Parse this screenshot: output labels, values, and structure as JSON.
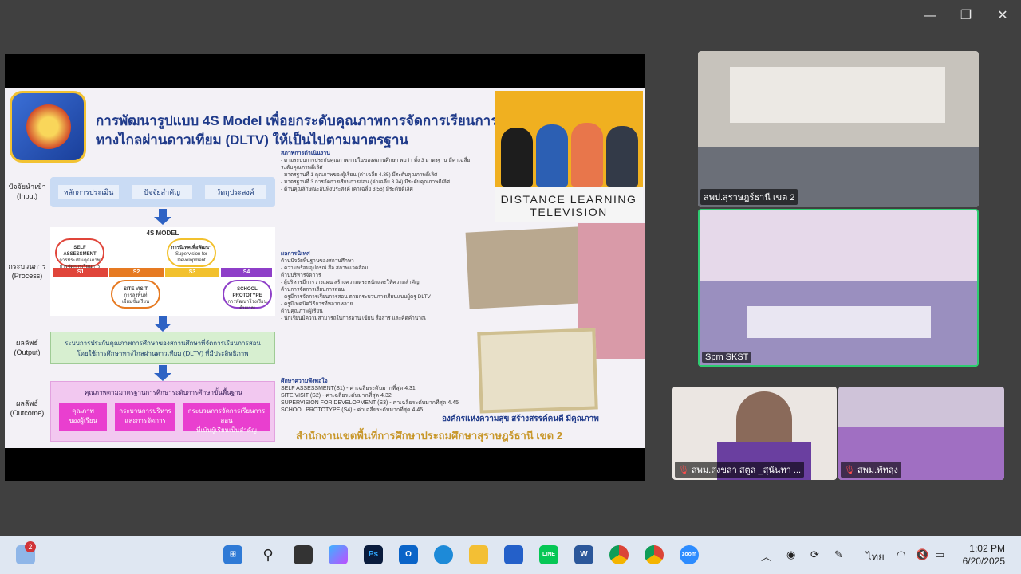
{
  "window": {
    "minimize": "—",
    "restore": "❐",
    "close": "✕"
  },
  "slide": {
    "title_line1": "การพัฒนารูปแบบ 4S Model เพื่อยกระดับคุณภาพการจัดการเรียนการสอน",
    "title_line2": "ทางไกลผ่านดาวเทียม (DLTV) ให้เป็นไปตามมาตรฐาน",
    "labels": {
      "input": "ปัจจัยนำเข้า\n(Input)",
      "process": "กระบวนการ\n(Process)",
      "output": "ผลลัพธ์\n(Output)",
      "outcome": "ผลลัพธ์\n(Outcome)"
    },
    "inputs": [
      "หลักการประเมิน",
      "ปัจจัยสำคัญ",
      "วัตถุประสงค์"
    ],
    "model_title": "4S MODEL",
    "steps": [
      {
        "code": "S1",
        "name": "SELF ASSESSMENT",
        "sub": "การประเมินคุณภาพ\nการจัดการเรียนการสอน"
      },
      {
        "code": "S2",
        "name": "SITE VISIT",
        "sub": "การลงพื้นที่\nเยี่ยมชั้นเรียน"
      },
      {
        "code": "S3",
        "name": "การนิเทศเพื่อพัฒนา",
        "sub": "Supervision for\nDevelopment"
      },
      {
        "code": "S4",
        "name": "SCHOOL PROTOTYPE",
        "sub": "การพัฒนาโรงเรียน\nต้นแบบ"
      }
    ],
    "output_text": "ระบบการประกันคุณภาพการศึกษาของสถานศึกษาที่จัดการเรียนการสอน\nโดยใช้การศึกษาทางไกลผ่านดาวเทียม (DLTV) ที่มีประสิทธิภาพ",
    "outcome_title": "คุณภาพตามมาตรฐานการศึกษาระดับการศึกษาขั้นพื้นฐาน",
    "outcomes": [
      "คุณภาพ\nของผู้เรียน",
      "กระบวนการบริหาร\nและการจัดการ",
      "กระบวนการจัดการเรียนการสอน\nที่เน้นผู้เรียนเป็นสำคัญ"
    ],
    "status_heading": "สภาพการดำเนินงาน",
    "status_text": "- ตามระบบการประกันคุณภาพภายในของสถานศึกษา พบว่า ทั้ง 3 มาตรฐาน มีค่าเฉลี่ยระดับคุณภาพดีเลิศ\n - มาตรฐานที่ 1 คุณภาพของผู้เรียน (ค่าเฉลี่ย 4.35) มีระดับคุณภาพดีเลิศ\n - มาตรฐานที่ 3 การจัดการเรียนการสอน (ค่าเฉลี่ย 3.94) มีระดับคุณภาพดีเลิศ\n - ด้านคุณลักษณะอันพึงประสงค์ (ค่าเฉลี่ย 3.56) มีระดับดีเลิศ",
    "results_heading": "ผลการนิเทศ",
    "results_text": "ด้านปัจจัยพื้นฐานของสถานศึกษา\n- ความพร้อมอุปกรณ์ สื่อ สภาพแวดล้อม\nด้านบริหารจัดการ\n- ผู้บริหารมีการวางแผน สร้างความตระหนักและให้ความสำคัญ\nด้านการจัดการเรียนการสอน\n- ครูมีการจัดการเรียนการสอน ตามกระบวนการเรียนแบบผู้ครู DLTV\n- ครูมีเทคนิควิธีการที่หลากหลาย\nด้านคุณภาพผู้เรียน\n- นักเรียนมีความสามารถในการอ่าน เขียน สื่อสาร และคิดคำนวณ",
    "satisfaction_heading": "ศึกษาความพึงพอใจ",
    "satisfaction": [
      "SELF ASSESSMENT(S1) - ค่าเฉลี่ยระดับมากที่สุด 4.31",
      "SITE VISIT (S2) - ค่าเฉลี่ยระดับมากที่สุด 4.32",
      "SUPERVISION FOR DEVELOPMENT (S3) - ค่าเฉลี่ยระดับมากที่สุด 4.45",
      "SCHOOL PROTOTYPE (S4) - ค่าเฉลี่ยระดับมากที่สุด 4.45"
    ],
    "dltv_text": "DISTANCE LEARNING\nTELEVISION",
    "footer_slogan": "องค์กรแห่งความสุข สร้างสรรค์คนดี มีคุณภาพ",
    "footer_org": "สำนักงานเขตพื้นที่การศึกษาประถมศึกษาสุราษฎร์ธานี เขต 2"
  },
  "participants": [
    {
      "name": "สพป.สุราษฎร์ธานี เขต 2",
      "muted": false
    },
    {
      "name": "Spm SKST",
      "muted": false,
      "active": true
    },
    {
      "name": "สพม.สงขลา สตูล _สุนันทา ...",
      "muted": true
    },
    {
      "name": "สพม.พัทลุง",
      "muted": true
    }
  ],
  "taskbar": {
    "weather_badge": "2",
    "apps": [
      "start-icon",
      "search-icon",
      "task-view-icon",
      "copilot-icon",
      "photoshop-icon",
      "outlook-icon",
      "edge-icon",
      "file-explorer-icon",
      "microsoft-365-icon",
      "line-icon",
      "word-icon",
      "chrome-icon",
      "chrome-profile-icon",
      "zoom-icon"
    ],
    "app_labels": {
      "photoshop": "Ps",
      "outlook": "O",
      "line": "LINE",
      "word": "W",
      "zoom": "zoom"
    },
    "lang": "ไทย",
    "time": "1:02 PM",
    "date": "6/20/2025"
  }
}
